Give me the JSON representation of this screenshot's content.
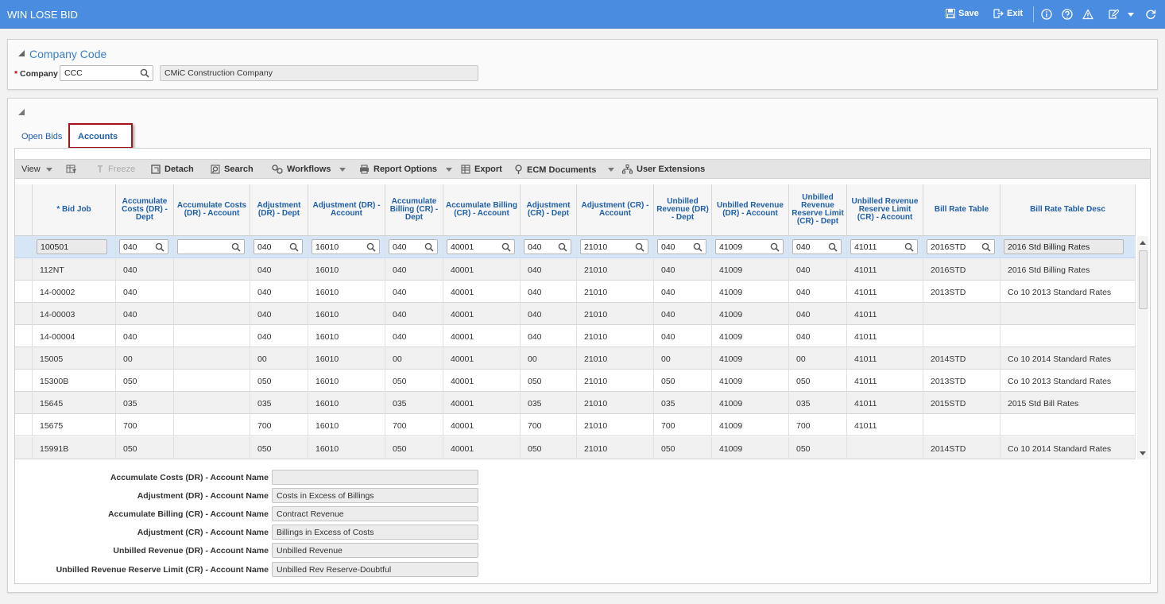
{
  "header": {
    "title": "WIN LOSE BID",
    "save_label": "Save",
    "exit_label": "Exit",
    "bg_color": "#4a8de0"
  },
  "company_section": {
    "title": "Company Code",
    "company_label": "Company",
    "required_mark": "*",
    "company_code": "CCC",
    "company_name": "CMiC Construction Company"
  },
  "tabs": [
    {
      "label": "Open Bids",
      "active": false
    },
    {
      "label": "Accounts",
      "active": true
    }
  ],
  "toolbar": {
    "view": "View",
    "freeze": "Freeze",
    "detach": "Detach",
    "search": "Search",
    "workflows": "Workflows",
    "report_options": "Report Options",
    "export": "Export",
    "ecm_documents": "ECM Documents",
    "user_extensions": "User Extensions"
  },
  "grid": {
    "columns": [
      "* Bid Job",
      "Accumulate Costs (DR) - Dept",
      "Accumulate Costs (DR) - Account",
      "Adjustment (DR) - Dept",
      "Adjustment (DR) - Account",
      "Accumulate Billing (CR) - Dept",
      "Accumulate Billing (CR) - Account",
      "Adjustment (CR) - Dept",
      "Adjustment (CR) - Account",
      "Unbilled Revenue (DR) - Dept",
      "Unbilled Revenue (DR) - Account",
      "Unbilled Revenue Reserve Limit (CR) - Dept",
      "Unbilled Revenue Reserve Limit (CR) - Account",
      "Bill Rate Table",
      "Bill Rate Table Desc"
    ],
    "selected_row": [
      "100501",
      "040",
      "",
      "040",
      "16010",
      "040",
      "40001",
      "040",
      "21010",
      "040",
      "41009",
      "040",
      "41011",
      "2016STD",
      "2016 Std Billing Rates"
    ],
    "rows": [
      [
        "112NT",
        "040",
        "",
        "040",
        "16010",
        "040",
        "40001",
        "040",
        "21010",
        "040",
        "41009",
        "040",
        "41011",
        "2016STD",
        "2016 Std Billing Rates"
      ],
      [
        "14-00002",
        "040",
        "",
        "040",
        "16010",
        "040",
        "40001",
        "040",
        "21010",
        "040",
        "41009",
        "040",
        "41011",
        "2013STD",
        "Co 10 2013 Standard Rates"
      ],
      [
        "14-00003",
        "040",
        "",
        "040",
        "16010",
        "040",
        "40001",
        "040",
        "21010",
        "040",
        "41009",
        "040",
        "41011",
        "",
        ""
      ],
      [
        "14-00004",
        "040",
        "",
        "040",
        "16010",
        "040",
        "40001",
        "040",
        "21010",
        "040",
        "41009",
        "040",
        "41011",
        "",
        ""
      ],
      [
        "15005",
        "00",
        "",
        "00",
        "16010",
        "00",
        "40001",
        "00",
        "21010",
        "00",
        "41009",
        "00",
        "41011",
        "2014STD",
        "Co 10 2014 Standard Rates"
      ],
      [
        "15300B",
        "050",
        "",
        "050",
        "16010",
        "050",
        "40001",
        "050",
        "21010",
        "050",
        "41009",
        "050",
        "41011",
        "2013STD",
        "Co 10 2013 Standard Rates"
      ],
      [
        "15645",
        "035",
        "",
        "035",
        "16010",
        "035",
        "40001",
        "035",
        "21010",
        "035",
        "41009",
        "035",
        "41011",
        "2015STD",
        "2015 Std Bill Rates"
      ],
      [
        "15675",
        "700",
        "",
        "700",
        "16010",
        "700",
        "40001",
        "700",
        "21010",
        "700",
        "41009",
        "700",
        "41011",
        "",
        ""
      ],
      [
        "15991B",
        "050",
        "",
        "050",
        "16010",
        "050",
        "40001",
        "050",
        "21010",
        "050",
        "41009",
        "050",
        "",
        "2014STD",
        "Co 10 2014 Standard Rates"
      ]
    ]
  },
  "details": [
    {
      "label": "Accumulate Costs (DR) - Account Name",
      "value": ""
    },
    {
      "label": "Adjustment (DR) - Account Name",
      "value": "Costs in Excess of Billings"
    },
    {
      "label": "Accumulate Billing (CR) - Account Name",
      "value": "Contract Revenue"
    },
    {
      "label": "Adjustment (CR) - Account Name",
      "value": "Billings in Excess of Costs"
    },
    {
      "label": "Unbilled Revenue (DR) - Account Name",
      "value": "Unbilled Revenue"
    },
    {
      "label": "Unbilled Revenue Reserve Limit (CR) - Account Name",
      "value": "Unbilled Rev Reserve-Doubtful"
    }
  ]
}
